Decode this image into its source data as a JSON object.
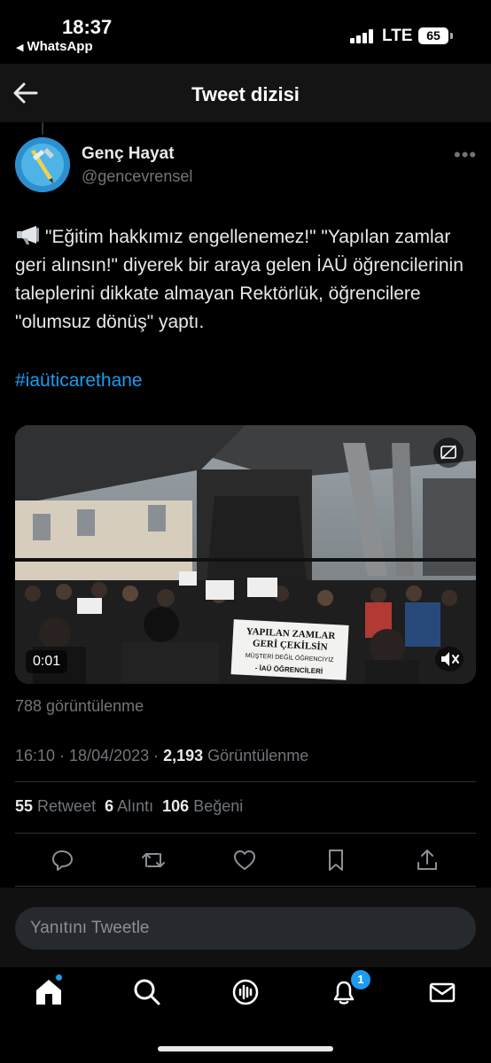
{
  "status_bar": {
    "time": "18:37",
    "back_app": "WhatsApp",
    "network": "LTE",
    "battery": "65"
  },
  "header": {
    "title": "Tweet dizisi",
    "back_icon": "arrow-left-icon"
  },
  "tweet": {
    "author_name": "Genç Hayat",
    "author_handle": "@gencevrensel",
    "text": "\"Eğitim hakkımız engellenemez!\" \"Yapılan zamlar geri alınsın!\" diyerek bir araya gelen İAÜ öğrencilerinin taleplerini dikkate almayan Rektörlük, öğrencilere \"olumsuz dönüş\" yaptı.",
    "hashtag": "#iaüticarethane",
    "media": {
      "duration": "0:01",
      "sign_line1": "YAPILAN ZAMLAR",
      "sign_line2": "GERİ ÇEKİLSİN",
      "sign_line3": "MÜŞTERİ DEĞİL ÖĞRENCİYİZ",
      "sign_line4": "- İAÜ ÖĞRENCİLERİ"
    },
    "video_views": "788 görüntülenme",
    "timestamp": "16:10 · 18/04/2023 · ",
    "views_count": "2,193",
    "views_label": " Görüntülenme",
    "retweets_count": "55",
    "retweets_label": "Retweet",
    "quotes_count": "6",
    "quotes_label": "Alıntı",
    "likes_count": "106",
    "likes_label": "Beğeni"
  },
  "reply": {
    "placeholder": "Yanıtını Tweetle"
  },
  "tabbar": {
    "notifications_badge": "1"
  },
  "colors": {
    "accent": "#1d9bf0",
    "background": "#000000",
    "text_primary": "#e7e9ea",
    "text_secondary": "#71767b"
  }
}
